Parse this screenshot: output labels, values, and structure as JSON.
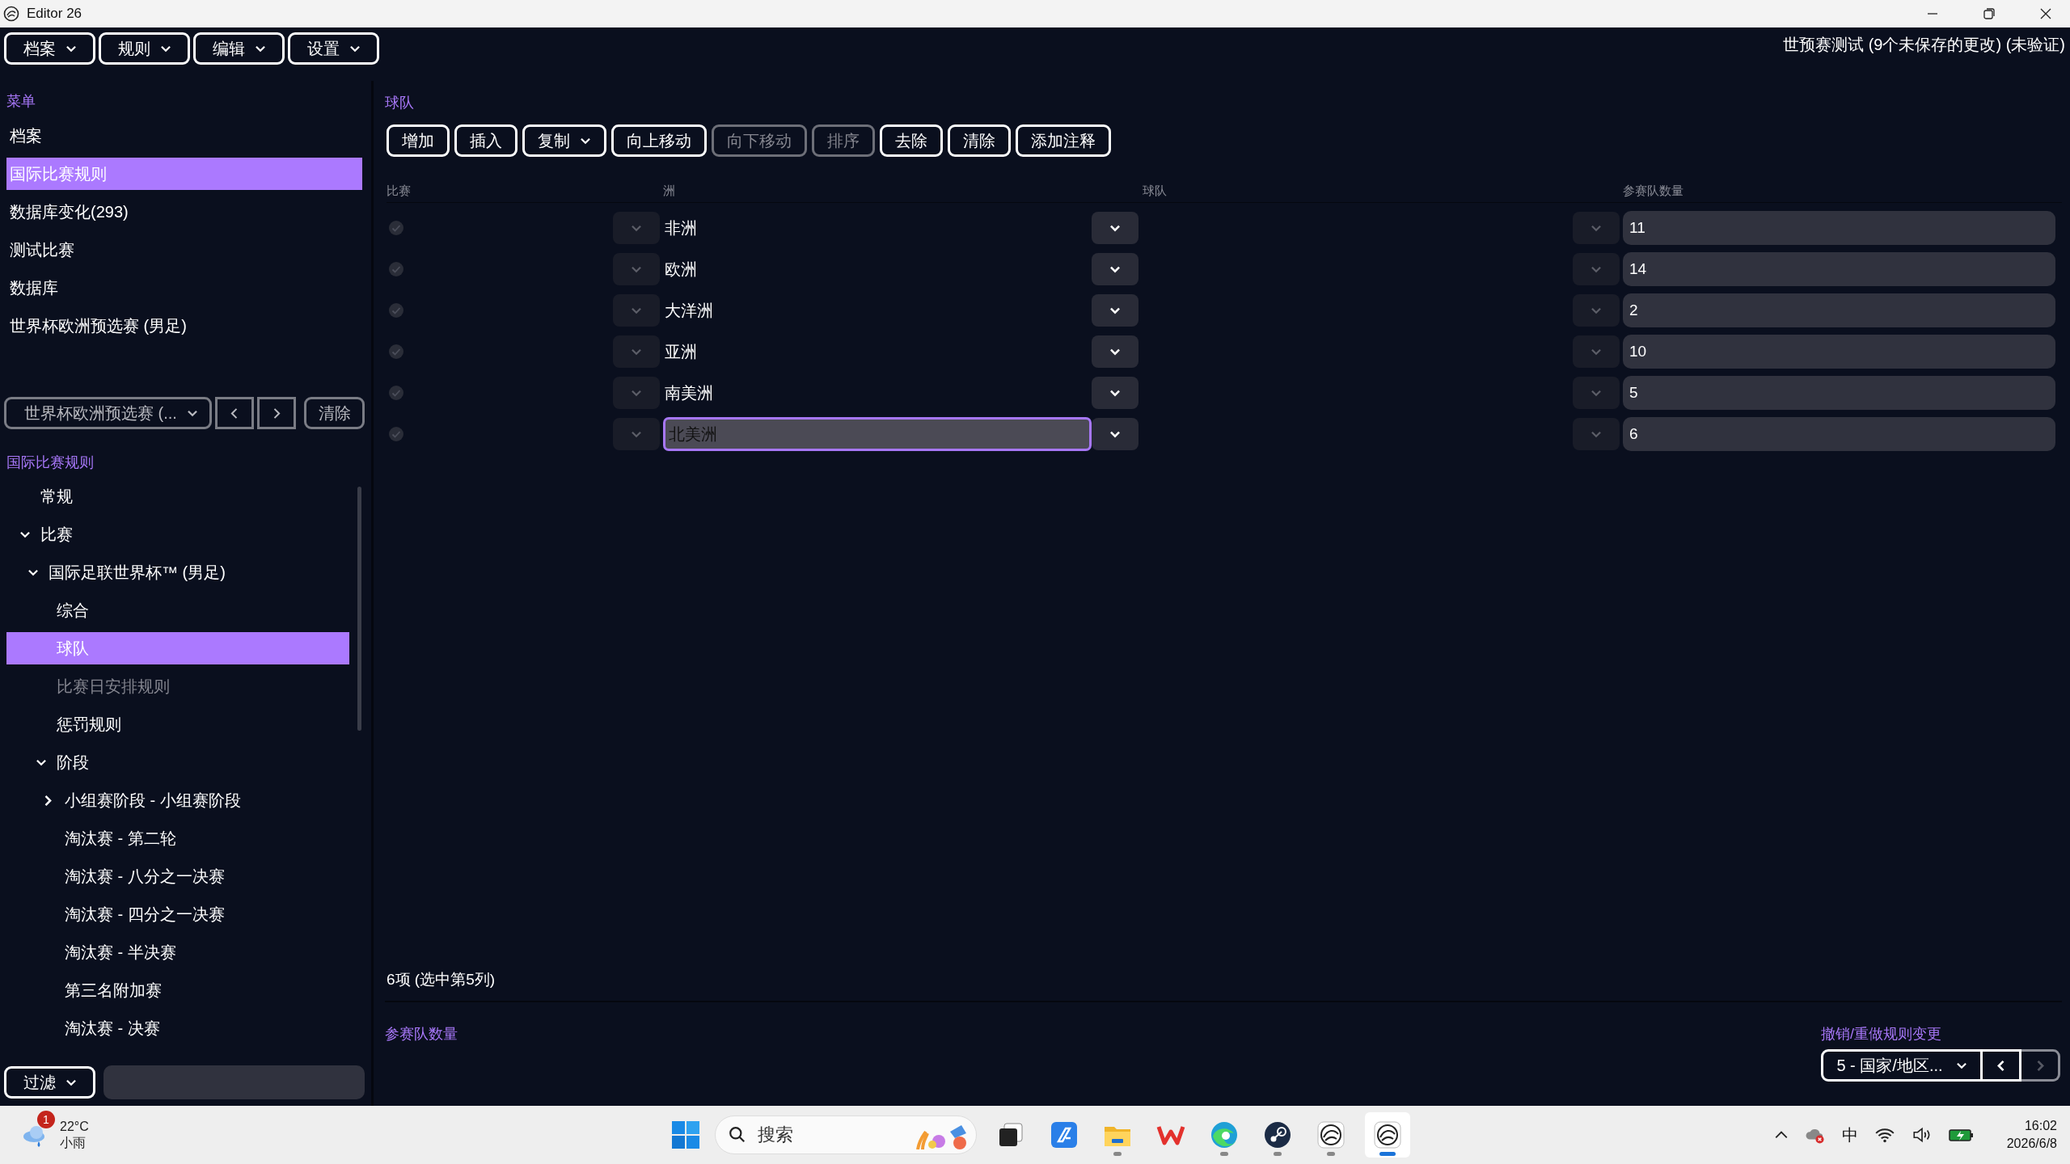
{
  "window": {
    "title": "Editor 26"
  },
  "menus": [
    "档案",
    "规则",
    "编辑",
    "设置"
  ],
  "project_status": "世预赛测试 (9个未保存的更改) (未验证)",
  "sidebar": {
    "heading": "菜单",
    "items": [
      {
        "label": "档案",
        "selected": false
      },
      {
        "label": "国际比赛规则",
        "selected": true
      },
      {
        "label": "数据库变化(293)",
        "selected": false
      },
      {
        "label": "测试比赛",
        "selected": false
      },
      {
        "label": "数据库",
        "selected": false
      },
      {
        "label": "世界杯欧洲预选赛 (男足)",
        "selected": false
      }
    ]
  },
  "competition_picker": {
    "value": "世界杯欧洲预选赛 (...",
    "clear": "清除"
  },
  "tree": {
    "heading": "国际比赛规则",
    "nodes": [
      {
        "label": "常规",
        "kind": "leaf",
        "selected": false,
        "disabled": false
      },
      {
        "label": "比赛",
        "kind": "branch",
        "expanded": true,
        "selected": false,
        "disabled": false,
        "children": [
          {
            "label": "国际足联世界杯™ (男足)",
            "kind": "branch",
            "expanded": true,
            "selected": false,
            "disabled": false,
            "children": [
              {
                "label": "综合",
                "kind": "leaf",
                "selected": false,
                "disabled": false
              },
              {
                "label": "球队",
                "kind": "leaf",
                "selected": true,
                "disabled": false
              },
              {
                "label": "比赛日安排规则",
                "kind": "leaf",
                "selected": false,
                "disabled": true
              },
              {
                "label": "惩罚规则",
                "kind": "leaf",
                "selected": false,
                "disabled": false
              },
              {
                "label": "阶段",
                "kind": "branch",
                "expanded": true,
                "selected": false,
                "disabled": false,
                "children": [
                  {
                    "label": "小组赛阶段 - 小组赛阶段",
                    "kind": "branch",
                    "expanded": false,
                    "selected": false,
                    "disabled": false
                  },
                  {
                    "label": "淘汰赛 - 第二轮",
                    "kind": "leaf",
                    "selected": false,
                    "disabled": false
                  },
                  {
                    "label": "淘汰赛 - 八分之一决赛",
                    "kind": "leaf",
                    "selected": false,
                    "disabled": false
                  },
                  {
                    "label": "淘汰赛 - 四分之一决赛",
                    "kind": "leaf",
                    "selected": false,
                    "disabled": false
                  },
                  {
                    "label": "淘汰赛 - 半决赛",
                    "kind": "leaf",
                    "selected": false,
                    "disabled": false
                  },
                  {
                    "label": "第三名附加赛",
                    "kind": "leaf",
                    "selected": false,
                    "disabled": false
                  },
                  {
                    "label": "淘汰赛 - 决赛",
                    "kind": "leaf",
                    "selected": false,
                    "disabled": false
                  }
                ]
              }
            ]
          }
        ]
      }
    ]
  },
  "filter": {
    "label": "过滤"
  },
  "panel": {
    "heading": "球队",
    "toolbar": [
      {
        "label": "增加",
        "disabled": false,
        "dropdown": false
      },
      {
        "label": "插入",
        "disabled": false,
        "dropdown": false
      },
      {
        "label": "复制",
        "disabled": false,
        "dropdown": true
      },
      {
        "label": "向上移动",
        "disabled": false,
        "dropdown": false
      },
      {
        "label": "向下移动",
        "disabled": true,
        "dropdown": false
      },
      {
        "label": "排序",
        "disabled": true,
        "dropdown": false
      },
      {
        "label": "去除",
        "disabled": false,
        "dropdown": false
      },
      {
        "label": "清除",
        "disabled": false,
        "dropdown": false
      },
      {
        "label": "添加注释",
        "disabled": false,
        "dropdown": false
      }
    ],
    "columns": [
      "比赛",
      "洲",
      "球队",
      "参赛队数量"
    ],
    "rows": [
      {
        "checked": true,
        "continent": "非洲",
        "count": "11",
        "editing": false
      },
      {
        "checked": true,
        "continent": "欧洲",
        "count": "14",
        "editing": false
      },
      {
        "checked": true,
        "continent": "大洋洲",
        "count": "2",
        "editing": false
      },
      {
        "checked": true,
        "continent": "亚洲",
        "count": "10",
        "editing": false
      },
      {
        "checked": true,
        "continent": "南美洲",
        "count": "5",
        "editing": false
      },
      {
        "checked": true,
        "continent": "北美洲",
        "count": "6",
        "editing": true
      }
    ],
    "status": "6项 (选中第5列)"
  },
  "detail_heading": "参赛队数量",
  "undo": {
    "heading": "撤销/重做规则变更",
    "value": "5 - 国家/地区...",
    "back_disabled": false,
    "forward_disabled": true
  },
  "taskbar": {
    "weather": {
      "badge": "1",
      "temperature": "22°C",
      "condition": "小雨"
    },
    "search": {
      "placeholder": "搜索"
    },
    "apps": [
      {
        "kind": "task-view",
        "running": false,
        "active": false
      },
      {
        "kind": "blue-app",
        "running": false,
        "active": false
      },
      {
        "kind": "folder",
        "running": true,
        "active": false
      },
      {
        "kind": "red-w",
        "running": false,
        "active": false
      },
      {
        "kind": "browser",
        "running": true,
        "active": false
      },
      {
        "kind": "game-client",
        "running": true,
        "active": false
      },
      {
        "kind": "editor",
        "running": true,
        "active": false
      },
      {
        "kind": "editor",
        "running": true,
        "active": true
      }
    ],
    "ime": "中",
    "time": "16:02",
    "date": "2026/6/8"
  }
}
